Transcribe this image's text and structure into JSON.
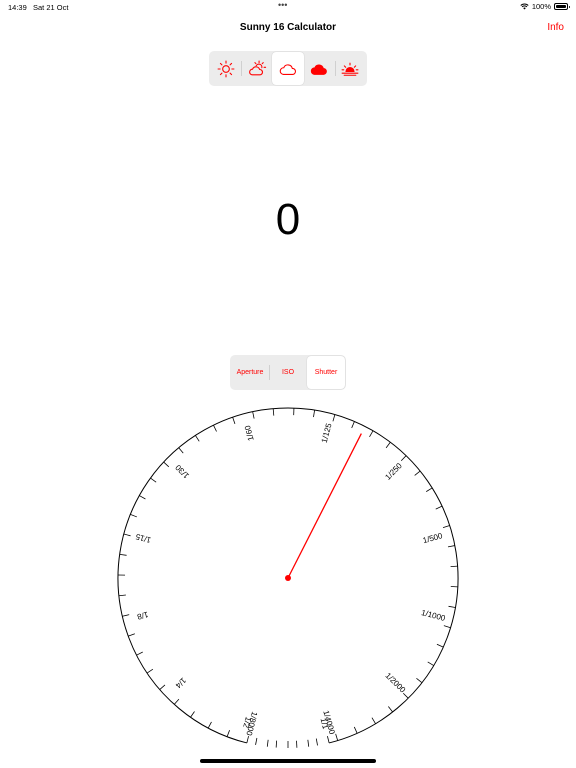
{
  "status_bar": {
    "time": "14:39",
    "date": "Sat 21 Oct",
    "dots": "•••",
    "battery": "100%"
  },
  "nav": {
    "title": "Sunny 16 Calculator",
    "info": "Info"
  },
  "weather_segments": [
    {
      "icon": "sun-icon",
      "selected": false
    },
    {
      "icon": "partly-cloudy-icon",
      "selected": false
    },
    {
      "icon": "cloud-icon",
      "selected": true
    },
    {
      "icon": "heavy-cloud-icon",
      "selected": false
    },
    {
      "icon": "sunset-icon",
      "selected": false
    }
  ],
  "result": {
    "value": "0"
  },
  "mode_segments": [
    {
      "label": "Aperture",
      "selected": false
    },
    {
      "label": "ISO",
      "selected": false
    },
    {
      "label": "Shutter",
      "selected": true
    }
  ],
  "dial": {
    "labels": [
      "1/1",
      "1/2",
      "1/4",
      "1/8",
      "1/15",
      "1/30",
      "1/60",
      "1/125",
      "1/250",
      "1/500",
      "1/1000",
      "1/2000",
      "1/4000",
      "1/8000"
    ],
    "selected": "1/125",
    "accent_color": "#ff0000"
  }
}
